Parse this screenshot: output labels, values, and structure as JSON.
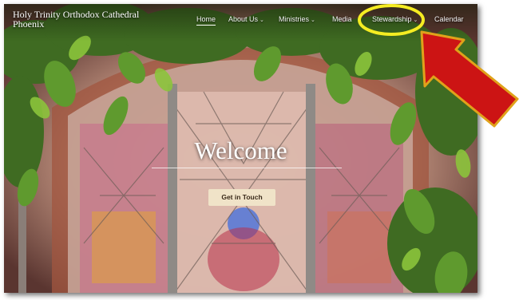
{
  "site": {
    "title": "Holy Trinity Orthodox Cathedral Phoenix"
  },
  "nav": {
    "home": "Home",
    "about": "About Us",
    "ministries": "Ministries",
    "media": "Media",
    "stewardship": "Stewardship",
    "calendar": "Calendar",
    "caret": "⌄"
  },
  "hero": {
    "heading": "Welcome",
    "button": "Get in Touch"
  },
  "annotations": {
    "highlight_color": "#f5ec22",
    "arrow_color": "#cc1414",
    "arrow_outline": "#e0a21a"
  }
}
